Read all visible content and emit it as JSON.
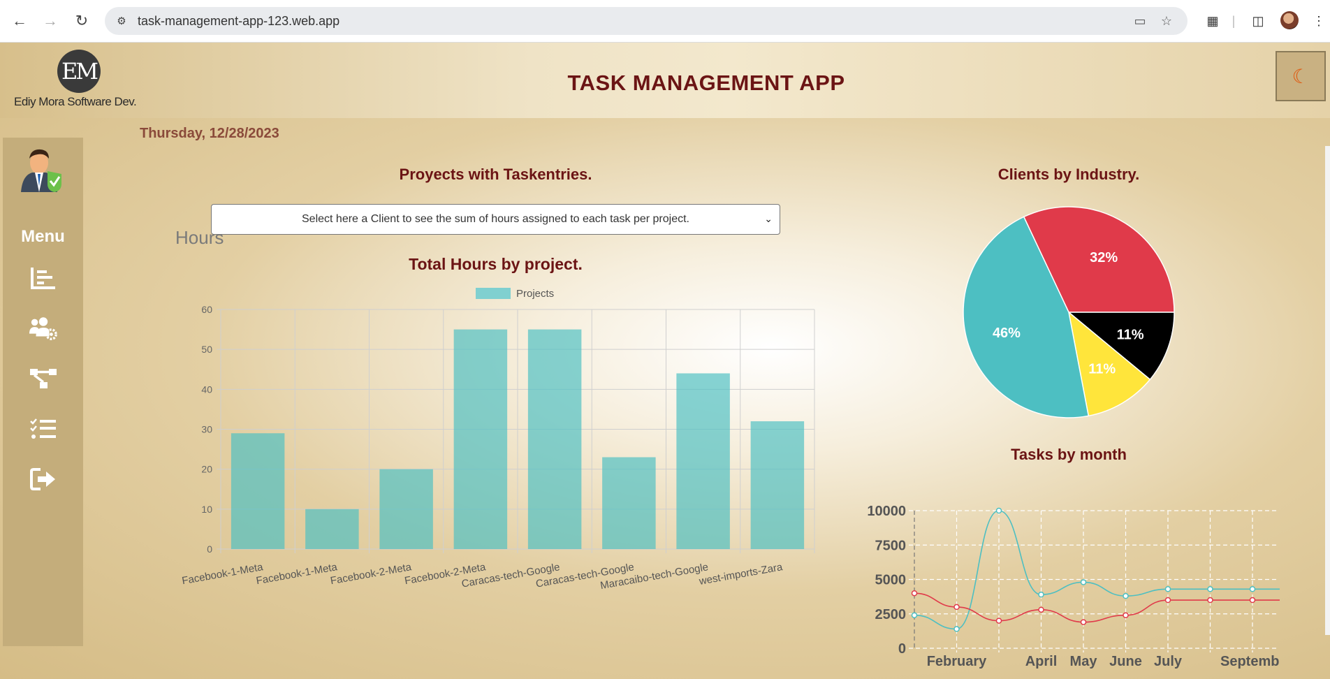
{
  "browser": {
    "url": "task-management-app-123.web.app"
  },
  "header": {
    "logo_mark": "EM",
    "logo_text": "Ediy Mora Software Dev.",
    "title": "TASK MANAGEMENT APP",
    "theme_icon": "moon-icon"
  },
  "date": "Thursday, 12/28/2023",
  "sidebar": {
    "menu_label": "Menu",
    "items": [
      {
        "icon": "bar-chart-icon"
      },
      {
        "icon": "users-gear-icon"
      },
      {
        "icon": "project-diagram-icon"
      },
      {
        "icon": "task-list-icon"
      },
      {
        "icon": "logout-icon"
      }
    ]
  },
  "projects_section": {
    "title": "Proyects with Taskentries.",
    "select_placeholder": "Select here a Client to see the sum of hours assigned to each task per project.",
    "chart_title": "Total Hours by project."
  },
  "clients_section": {
    "title": "Clients by Industry."
  },
  "tasks_section": {
    "title": "Tasks by month"
  },
  "colors": {
    "teal": "#4dbfc2",
    "red": "#e03a4a",
    "yellow": "#ffe53b",
    "black": "#000000",
    "title_red": "#6b1414"
  },
  "chart_data": [
    {
      "type": "bar",
      "title": "Total Hours by project.",
      "ylabel": "Hours",
      "legend": [
        "Projects"
      ],
      "legend_position": "top",
      "categories": [
        "Facebook-1-Meta",
        "Facebook-1-Meta",
        "Facebook-2-Meta",
        "Facebook-2-Meta",
        "Caracas-tech-Google",
        "Caracas-tech-Google",
        "Maracaibo-tech-Google",
        "west-imports-Zara"
      ],
      "series": [
        {
          "name": "Projects",
          "values": [
            29,
            10,
            20,
            55,
            55,
            23,
            44,
            32
          ]
        }
      ],
      "ylim": [
        0,
        60
      ],
      "yticks": [
        0,
        10,
        20,
        30,
        40,
        50,
        60
      ],
      "grid": true
    },
    {
      "type": "pie",
      "title": "Clients by Industry.",
      "labels": [
        "32%",
        "11%",
        "11%",
        "46%"
      ],
      "values": [
        32,
        11,
        11,
        46
      ],
      "colors": [
        "#e03a4a",
        "#000000",
        "#ffe53b",
        "#4dbfc2"
      ]
    },
    {
      "type": "line",
      "title": "Tasks by month",
      "x_tick_labels": [
        "February",
        "April",
        "May",
        "June",
        "July",
        "Septemb"
      ],
      "ylim": [
        0,
        10000
      ],
      "yticks": [
        0,
        2500,
        5000,
        7500,
        10000
      ],
      "grid": true,
      "series": [
        {
          "values": [
            2400,
            1400,
            10000,
            3900,
            4800,
            3800,
            4300,
            4300,
            4300,
            4300
          ]
        },
        {
          "values": [
            4000,
            3000,
            2000,
            2800,
            1900,
            2400,
            3500,
            3500,
            3500,
            3500
          ]
        }
      ],
      "series_colors": [
        "#4dbfc2",
        "#e03a4a"
      ]
    }
  ]
}
